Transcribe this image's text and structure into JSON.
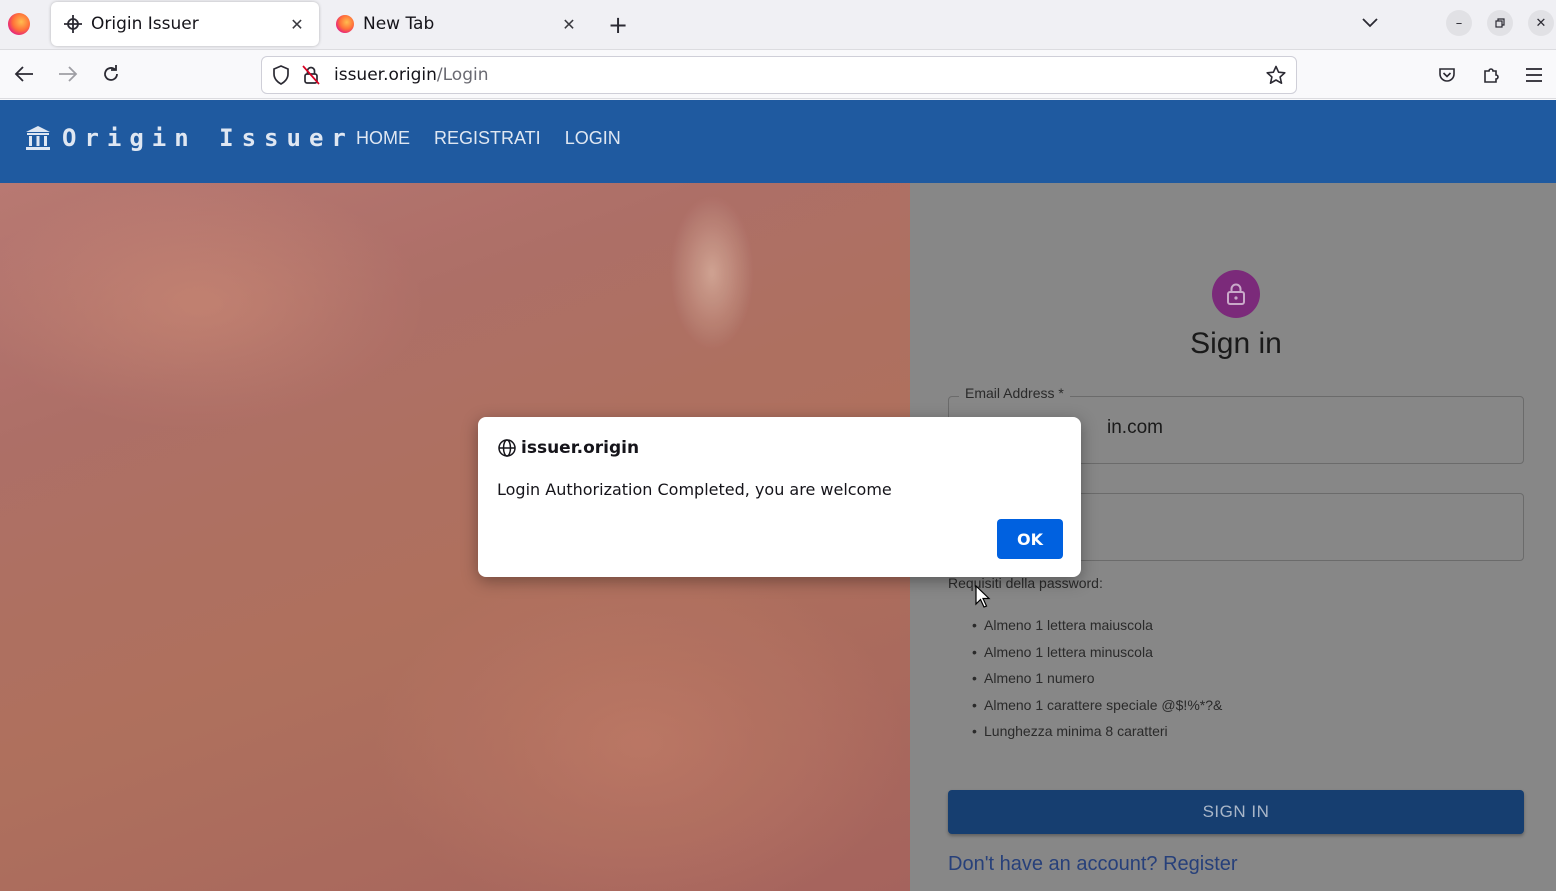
{
  "browser": {
    "tabs": [
      {
        "title": "Origin Issuer",
        "active": true
      },
      {
        "title": "New Tab",
        "active": false
      }
    ],
    "url": {
      "domain": "issuer.origin",
      "path": "/Login"
    }
  },
  "app": {
    "brand": "Origin Issuer",
    "nav": [
      "HOME",
      "REGISTRATI",
      "LOGIN"
    ]
  },
  "signin": {
    "title": "Sign in",
    "email_label": "Email Address *",
    "email_value_visible": "in.com",
    "password_requirements_title": "Requisiti della password:",
    "requirements": [
      "Almeno 1 lettera maiuscola",
      "Almeno 1 lettera minuscola",
      "Almeno 1 numero",
      "Almeno 1 carattere speciale @$!%*?&",
      "Lunghezza minima 8 caratteri"
    ],
    "button": "SIGN IN",
    "register_link": "Don't have an account? Register"
  },
  "dialog": {
    "origin": "issuer.origin",
    "message": "Login Authorization Completed, you are welcome",
    "ok_label": "OK"
  },
  "colors": {
    "appbar": "#1f5aa0",
    "lock_badge": "#7b2a7a",
    "ok_button": "#0061e0",
    "signin_button": "#163e70"
  }
}
